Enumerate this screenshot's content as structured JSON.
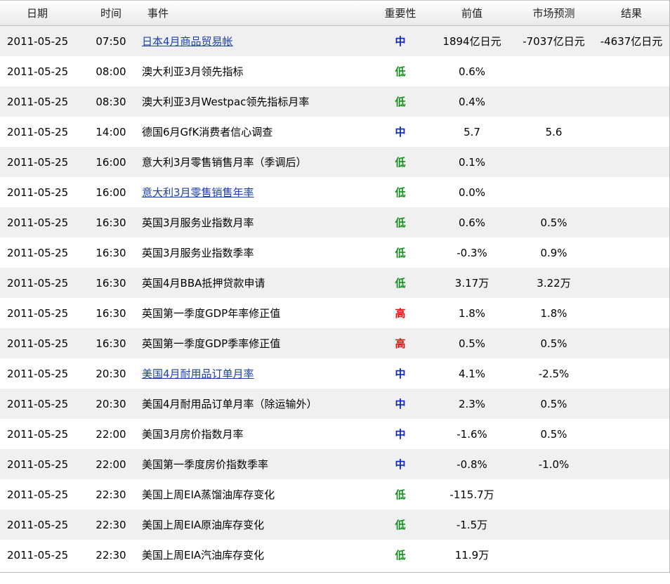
{
  "header": {
    "date": "日期",
    "time": "时间",
    "event": "事件",
    "importance": "重要性",
    "previous": "前值",
    "forecast": "市场预测",
    "result": "结果"
  },
  "rows": [
    {
      "date": "2011-05-25",
      "time": "07:50",
      "event": "日本4月商品贸易帐",
      "link": true,
      "importance": "中",
      "level": "mid",
      "previous": "1894亿日元",
      "forecast": "-7037亿日元",
      "result": "-4637亿日元"
    },
    {
      "date": "2011-05-25",
      "time": "08:00",
      "event": "澳大利亚3月领先指标",
      "link": false,
      "importance": "低",
      "level": "low",
      "previous": "0.6%",
      "forecast": "",
      "result": ""
    },
    {
      "date": "2011-05-25",
      "time": "08:30",
      "event": "澳大利亚3月Westpac领先指标月率",
      "link": false,
      "importance": "低",
      "level": "low",
      "previous": "0.4%",
      "forecast": "",
      "result": ""
    },
    {
      "date": "2011-05-25",
      "time": "14:00",
      "event": "德国6月GfK消费者信心调查",
      "link": false,
      "importance": "中",
      "level": "mid",
      "previous": "5.7",
      "forecast": "5.6",
      "result": ""
    },
    {
      "date": "2011-05-25",
      "time": "16:00",
      "event": "意大利3月零售销售月率（季调后）",
      "link": false,
      "importance": "低",
      "level": "low",
      "previous": "0.1%",
      "forecast": "",
      "result": ""
    },
    {
      "date": "2011-05-25",
      "time": "16:00",
      "event": "意大利3月零售销售年率",
      "link": true,
      "importance": "低",
      "level": "low",
      "previous": "0.0%",
      "forecast": "",
      "result": ""
    },
    {
      "date": "2011-05-25",
      "time": "16:30",
      "event": "英国3月服务业指数月率",
      "link": false,
      "importance": "低",
      "level": "low",
      "previous": "0.6%",
      "forecast": "0.5%",
      "result": ""
    },
    {
      "date": "2011-05-25",
      "time": "16:30",
      "event": "英国3月服务业指数季率",
      "link": false,
      "importance": "低",
      "level": "low",
      "previous": "-0.3%",
      "forecast": "0.9%",
      "result": ""
    },
    {
      "date": "2011-05-25",
      "time": "16:30",
      "event": "英国4月BBA抵押贷款申请",
      "link": false,
      "importance": "低",
      "level": "low",
      "previous": "3.17万",
      "forecast": "3.22万",
      "result": ""
    },
    {
      "date": "2011-05-25",
      "time": "16:30",
      "event": "英国第一季度GDP年率修正值",
      "link": false,
      "importance": "高",
      "level": "high",
      "previous": "1.8%",
      "forecast": "1.8%",
      "result": ""
    },
    {
      "date": "2011-05-25",
      "time": "16:30",
      "event": "英国第一季度GDP季率修正值",
      "link": false,
      "importance": "高",
      "level": "high",
      "previous": "0.5%",
      "forecast": "0.5%",
      "result": ""
    },
    {
      "date": "2011-05-25",
      "time": "20:30",
      "event": "美国4月耐用品订单月率",
      "link": true,
      "importance": "中",
      "level": "mid",
      "previous": "4.1%",
      "forecast": "-2.5%",
      "result": ""
    },
    {
      "date": "2011-05-25",
      "time": "20:30",
      "event": "美国4月耐用品订单月率（除运输外）",
      "link": false,
      "importance": "中",
      "level": "mid",
      "previous": "2.3%",
      "forecast": "0.5%",
      "result": ""
    },
    {
      "date": "2011-05-25",
      "time": "22:00",
      "event": "美国3月房价指数月率",
      "link": false,
      "importance": "中",
      "level": "mid",
      "previous": "-1.6%",
      "forecast": "0.5%",
      "result": ""
    },
    {
      "date": "2011-05-25",
      "time": "22:00",
      "event": "美国第一季度房价指数季率",
      "link": false,
      "importance": "中",
      "level": "mid",
      "previous": "-0.8%",
      "forecast": "-1.0%",
      "result": ""
    },
    {
      "date": "2011-05-25",
      "time": "22:30",
      "event": "美国上周EIA蒸馏油库存变化",
      "link": false,
      "importance": "低",
      "level": "low",
      "previous": "-115.7万",
      "forecast": "",
      "result": ""
    },
    {
      "date": "2011-05-25",
      "time": "22:30",
      "event": "美国上周EIA原油库存变化",
      "link": false,
      "importance": "低",
      "level": "low",
      "previous": "-1.5万",
      "forecast": "",
      "result": ""
    },
    {
      "date": "2011-05-25",
      "time": "22:30",
      "event": "美国上周EIA汽油库存变化",
      "link": false,
      "importance": "低",
      "level": "low",
      "previous": "11.9万",
      "forecast": "",
      "result": ""
    }
  ],
  "colors": {
    "mid": "#0b24c7",
    "low": "#14911e",
    "high": "#e01010",
    "link": "#1a3fa8",
    "row_alt": "#f0f0f0"
  }
}
